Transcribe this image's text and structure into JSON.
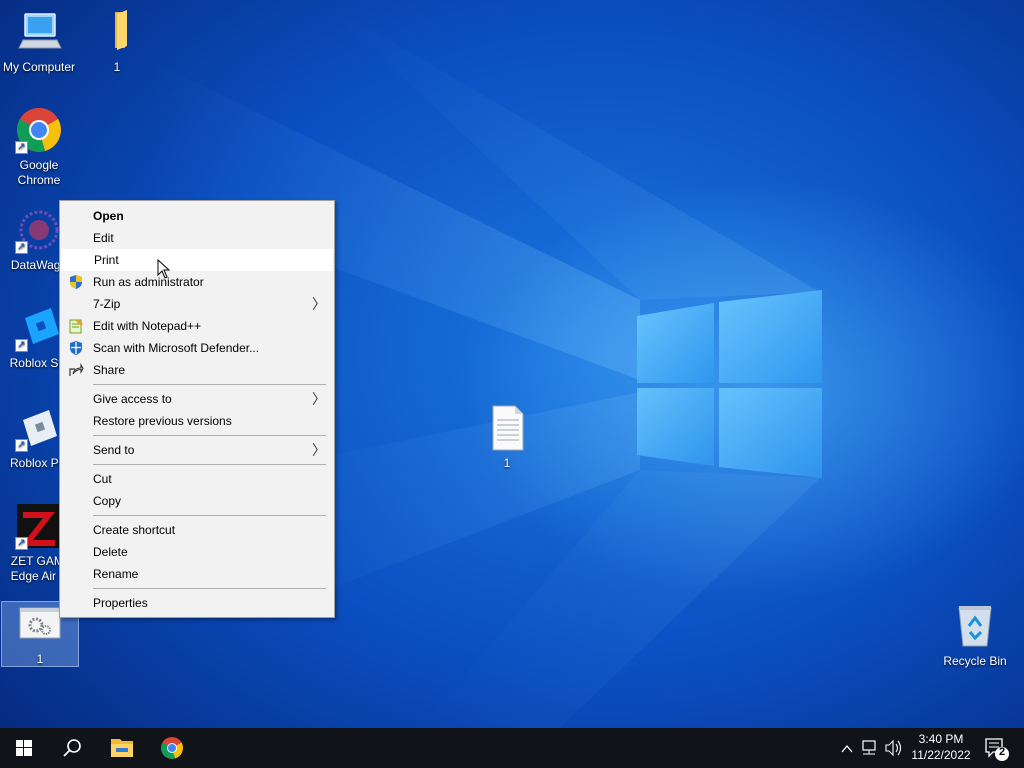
{
  "desktop_icons": [
    {
      "label": "My Computer",
      "icon": "computer-icon"
    },
    {
      "label": "1",
      "icon": "folder-icon"
    },
    {
      "label": "Google Chrome",
      "icon": "chrome-icon",
      "shortcut": true
    },
    {
      "label": "DataWago",
      "icon": "datawago-icon",
      "shortcut": true
    },
    {
      "label": "Roblox Stu",
      "icon": "roblox-studio-icon",
      "shortcut": true
    },
    {
      "label": "Roblox Pla",
      "icon": "roblox-player-icon",
      "shortcut": true
    },
    {
      "label": "ZET GAMI Edge Air P",
      "icon": "zet-gaming-icon",
      "shortcut": true
    },
    {
      "label": "1",
      "icon": "settings-file-icon",
      "selected": true
    },
    {
      "label": "1",
      "icon": "text-document-icon"
    },
    {
      "label": "Recycle Bin",
      "icon": "recycle-bin-icon"
    }
  ],
  "context_menu": {
    "items": [
      {
        "label": "Open",
        "bold": true
      },
      {
        "label": "Edit"
      },
      {
        "label": "Print",
        "hovered": true
      },
      {
        "label": "Run as administrator",
        "icon": "uac-shield-icon"
      },
      {
        "label": "7-Zip",
        "submenu": true
      },
      {
        "label": "Edit with Notepad++",
        "icon": "notepadpp-icon"
      },
      {
        "label": "Scan with Microsoft Defender...",
        "icon": "defender-icon"
      },
      {
        "label": "Share",
        "icon": "share-icon"
      },
      {
        "label": "Give access to",
        "submenu": true
      },
      {
        "label": "Restore previous versions"
      },
      {
        "label": "Send to",
        "submenu": true
      },
      {
        "label": "Cut"
      },
      {
        "label": "Copy"
      },
      {
        "label": "Create shortcut"
      },
      {
        "label": "Delete"
      },
      {
        "label": "Rename"
      },
      {
        "label": "Properties"
      }
    ]
  },
  "taskbar": {
    "start": "windows-start-icon",
    "search": "search-icon",
    "pinned": [
      "file-explorer-icon",
      "chrome-icon"
    ],
    "tray": {
      "time": "3:40 PM",
      "date": "11/22/2022",
      "notifications_count": "2"
    }
  },
  "colors": {
    "accent": "#0b5fd0",
    "taskbar": "#101318",
    "menu_bg": "#f2f2f2"
  }
}
